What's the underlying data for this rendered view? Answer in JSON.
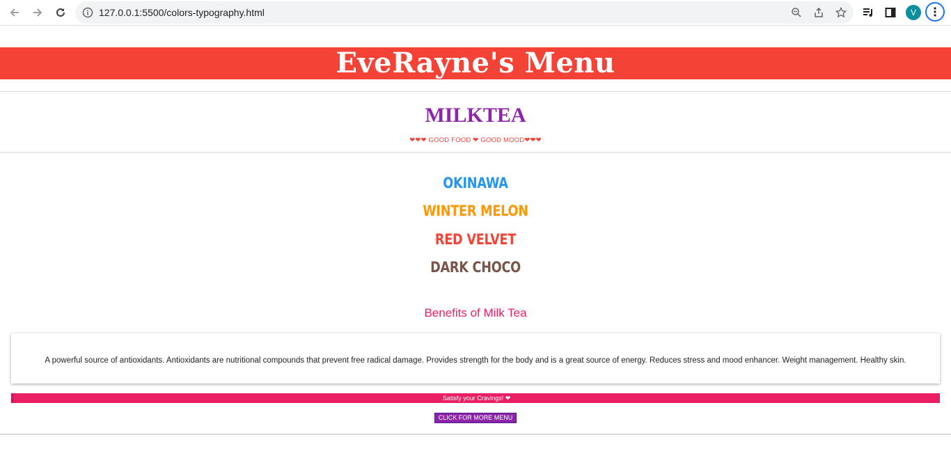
{
  "browser": {
    "url": "127.0.0.1:5500/colors-typography.html",
    "profile_initial": "V",
    "icons": [
      "back-icon",
      "forward-icon",
      "reload-icon",
      "info-icon",
      "zoom-icon",
      "share-icon",
      "star-icon",
      "media-icon",
      "side-panel-icon",
      "menu-icon"
    ]
  },
  "page": {
    "banner_title": "EveRayne's Menu",
    "subtitle": "MILKTEA",
    "tagline": "❤❤❤ GOOD FOOD ❤ GOOD MOOD❤❤❤",
    "flavors": [
      {
        "name": "OKINAWA",
        "color": "#2196f3"
      },
      {
        "name": "WINTER MELON",
        "color": "#ff9800"
      },
      {
        "name": "RED VELVET",
        "color": "#f44336"
      },
      {
        "name": "DARK CHOCO",
        "color": "#795548"
      }
    ],
    "benefits_heading": "Benefits of Milk Tea",
    "benefits_text": "A powerful source of antioxidants. Antioxidants are nutritional compounds that prevent free radical damage. Provides strength for the body and is a great source of energy. Reduces stress and mood enhancer. Weight management. Healthy skin.",
    "cravings_text": "Satisfy your Cravings! ❤",
    "more_button": "CLICK FOR MORE MENU"
  },
  "colors": {
    "banner": "#f44336",
    "subtitle": "#8e24aa",
    "accent_pink": "#e91e63",
    "button": "#8e24aa"
  }
}
